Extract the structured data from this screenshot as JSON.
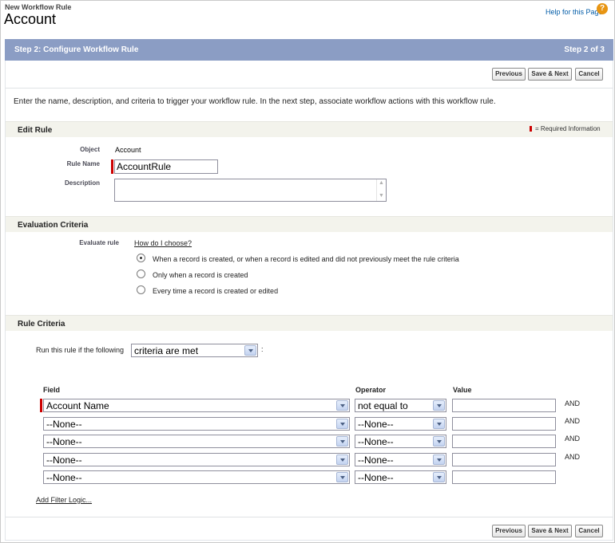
{
  "header": {
    "breadcrumb": "New Workflow Rule",
    "title": "Account",
    "help_link": "Help for this Page",
    "help_icon": "question-icon"
  },
  "step": {
    "title": "Step 2: Configure Workflow Rule",
    "counter": "Step 2 of 3"
  },
  "buttons": {
    "previous": "Previous",
    "save_next": "Save & Next",
    "cancel": "Cancel"
  },
  "intro": "Enter the name, description, and criteria to trigger your workflow rule. In the next step, associate workflow actions with this workflow rule.",
  "edit_rule": {
    "heading": "Edit Rule",
    "required_info": "= Required Information",
    "object_label": "Object",
    "object_value": "Account",
    "rule_name_label": "Rule Name",
    "rule_name_value": "AccountRule",
    "description_label": "Description",
    "description_value": ""
  },
  "evaluation": {
    "heading": "Evaluation Criteria",
    "evaluate_label": "Evaluate rule",
    "how_link": "How do I choose?",
    "options": [
      {
        "label": "When a record is created, or when a record is edited and did not previously meet the rule criteria",
        "checked": true
      },
      {
        "label": "Only when a record is created",
        "checked": false
      },
      {
        "label": "Every time a record is created or edited",
        "checked": false
      }
    ]
  },
  "rule_criteria": {
    "heading": "Rule Criteria",
    "run_label": "Run this rule if the following",
    "run_select": "criteria are met",
    "colon": ":",
    "columns": {
      "field": "Field",
      "operator": "Operator",
      "value": "Value"
    },
    "rows": [
      {
        "field": "Account Name",
        "operator": "not equal to",
        "value": "",
        "conjunction": "AND"
      },
      {
        "field": "--None--",
        "operator": "--None--",
        "value": "",
        "conjunction": "AND"
      },
      {
        "field": "--None--",
        "operator": "--None--",
        "value": "",
        "conjunction": "AND"
      },
      {
        "field": "--None--",
        "operator": "--None--",
        "value": "",
        "conjunction": "AND"
      },
      {
        "field": "--None--",
        "operator": "--None--",
        "value": "",
        "conjunction": ""
      }
    ],
    "add_filter_logic": "Add Filter Logic..."
  },
  "colors": {
    "step_bar": "#8b9dc4",
    "section_bg": "#f3f3ec",
    "required": "#cc0000",
    "link": "#015ba7"
  }
}
